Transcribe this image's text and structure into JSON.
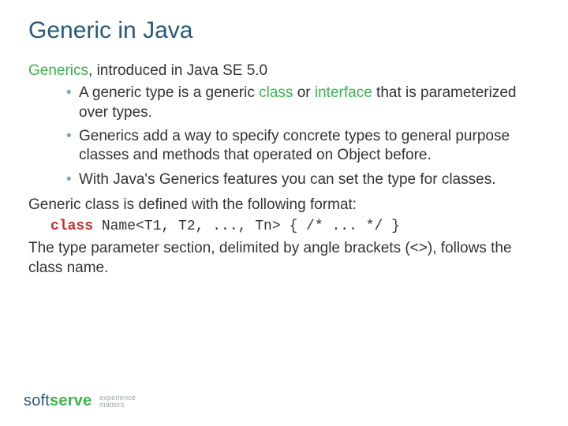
{
  "title": "Generic in Java",
  "intro": {
    "lead": "Generics",
    "rest": ", introduced in Java SE 5.0"
  },
  "bullets": [
    {
      "pre": "A generic type is a generic ",
      "kw1": "class",
      "mid": " or ",
      "kw2": "interface",
      "post": " that is parameterized over types."
    },
    {
      "text": "Generics add a way to specify concrete types to general purpose classes and methods that operated on Object before."
    },
    {
      "text": "With Java's Generics features you can set the type for classes."
    }
  ],
  "format_line": "Generic class is defined with the following format:",
  "code": {
    "kw": "class",
    "rest": " Name<T1, T2, ..., Tn> { /* ... */ }"
  },
  "closing": "The type parameter section, delimited by angle brackets (<>), follows the class name.",
  "logo": {
    "soft": "soft",
    "serve": "serve",
    "tag1": "experience",
    "tag2": "matters"
  }
}
